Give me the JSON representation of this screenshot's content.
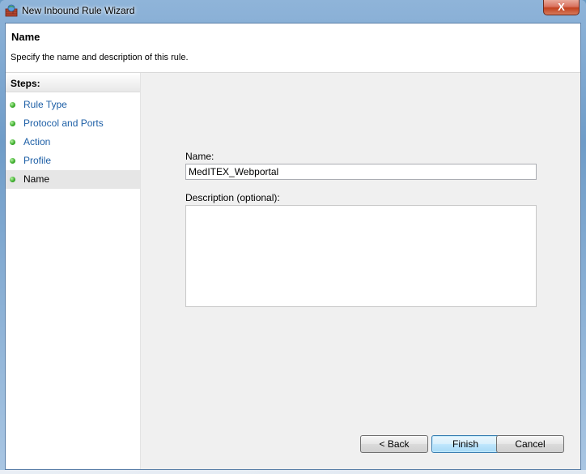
{
  "window": {
    "title": "New Inbound Rule Wizard",
    "close_label": "X"
  },
  "header": {
    "title": "Name",
    "subtitle": "Specify the name and description of this rule."
  },
  "steps": {
    "heading": "Steps:",
    "items": [
      {
        "label": "Rule Type",
        "status": "completed"
      },
      {
        "label": "Protocol and Ports",
        "status": "completed"
      },
      {
        "label": "Action",
        "status": "completed"
      },
      {
        "label": "Profile",
        "status": "completed"
      },
      {
        "label": "Name",
        "status": "current"
      }
    ]
  },
  "form": {
    "name_label": "Name:",
    "name_value": "MedITEX_Webportal",
    "description_label": "Description (optional):",
    "description_value": ""
  },
  "buttons": {
    "back": "< Back",
    "finish": "Finish",
    "cancel": "Cancel"
  },
  "colors": {
    "step_link": "#1d5fa6",
    "step_dot": "#3fb02f",
    "default_button": "#bee6fd"
  }
}
